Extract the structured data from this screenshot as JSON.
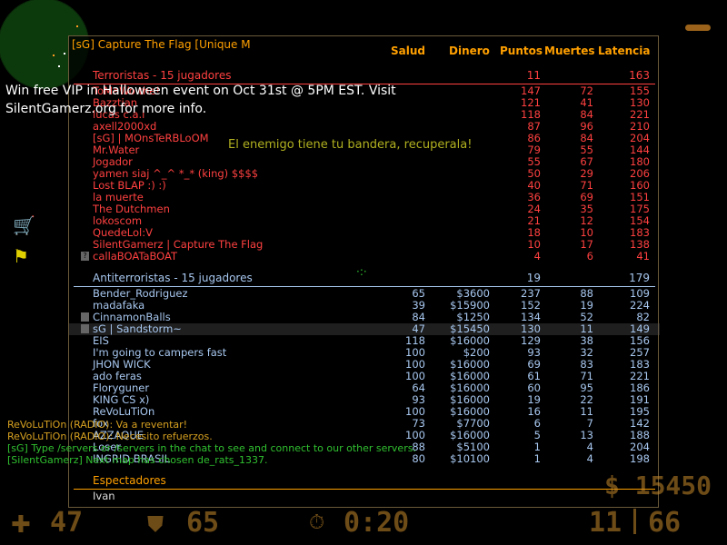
{
  "server_title": "[sG] Capture The Flag [Unique M",
  "columns": {
    "health": "Salud",
    "money": "Dinero",
    "points": "Puntos",
    "deaths": "Muertes",
    "latency": "Latencia"
  },
  "terrorists": {
    "header": "Terroristas   -  15 jugadores",
    "points": "11",
    "latency": "163",
    "players": [
      {
        "name": "ToMaWo  the!",
        "pts": "147",
        "deaths": "72",
        "lat": "155"
      },
      {
        "name": "Bazztian",
        "pts": "121",
        "deaths": "41",
        "lat": "130"
      },
      {
        "name": "lucas c.a.l",
        "pts": "118",
        "deaths": "84",
        "lat": "221"
      },
      {
        "name": "axell2000xd",
        "pts": "87",
        "deaths": "96",
        "lat": "210"
      },
      {
        "name": "[sG] | MOnsTeRBLoOM",
        "pts": "86",
        "deaths": "84",
        "lat": "204"
      },
      {
        "name": "Mr.Water",
        "pts": "79",
        "deaths": "55",
        "lat": "144"
      },
      {
        "name": "Jogador",
        "pts": "55",
        "deaths": "67",
        "lat": "180"
      },
      {
        "name": "yamen siaj ^_^ *_* (king) $$$$",
        "pts": "50",
        "deaths": "29",
        "lat": "206"
      },
      {
        "name": "Lost BLAP :) :)",
        "pts": "40",
        "deaths": "71",
        "lat": "160"
      },
      {
        "name": "la muerte",
        "pts": "36",
        "deaths": "69",
        "lat": "151"
      },
      {
        "name": "The Dutchmen",
        "pts": "24",
        "deaths": "35",
        "lat": "175"
      },
      {
        "name": "lokoscom",
        "pts": "21",
        "deaths": "12",
        "lat": "154"
      },
      {
        "name": "QuedeLol:V",
        "pts": "18",
        "deaths": "10",
        "lat": "183"
      },
      {
        "name": "SilentGamerz | Capture The Flag",
        "pts": "10",
        "deaths": "17",
        "lat": "138"
      },
      {
        "name": "callaBOATaBOAT",
        "pts": "4",
        "deaths": "6",
        "lat": "41"
      }
    ]
  },
  "counter_terrorists": {
    "header": "Antiterroristas   -  15 jugadores",
    "points": "19",
    "latency": "179",
    "players": [
      {
        "name": "Bender_Rodriguez",
        "hp": "65",
        "money": "$3600",
        "pts": "237",
        "deaths": "88",
        "lat": "109"
      },
      {
        "name": "madafaka",
        "hp": "39",
        "money": "$15900",
        "pts": "152",
        "deaths": "19",
        "lat": "224"
      },
      {
        "name": "CinnamonBalls",
        "hp": "84",
        "money": "$1250",
        "pts": "134",
        "deaths": "52",
        "lat": "82"
      },
      {
        "name": "sG | Sandstorm~",
        "hp": "47",
        "money": "$15450",
        "pts": "130",
        "deaths": "11",
        "lat": "149"
      },
      {
        "name": "EIS",
        "hp": "118",
        "money": "$16000",
        "pts": "129",
        "deaths": "38",
        "lat": "156"
      },
      {
        "name": "I'm going to campers fast",
        "hp": "100",
        "money": "$200",
        "pts": "93",
        "deaths": "32",
        "lat": "257"
      },
      {
        "name": "JHON WICK",
        "hp": "100",
        "money": "$16000",
        "pts": "69",
        "deaths": "83",
        "lat": "183"
      },
      {
        "name": "ado feras",
        "hp": "100",
        "money": "$16000",
        "pts": "61",
        "deaths": "71",
        "lat": "221"
      },
      {
        "name": "Floryguner",
        "hp": "64",
        "money": "$16000",
        "pts": "60",
        "deaths": "95",
        "lat": "186"
      },
      {
        "name": "KING CS x)",
        "hp": "93",
        "money": "$16000",
        "pts": "19",
        "deaths": "22",
        "lat": "191"
      },
      {
        "name": "ReVoLuTiOn",
        "hp": "100",
        "money": "$16000",
        "pts": "16",
        "deaths": "11",
        "lat": "195"
      },
      {
        "name": "fox",
        "hp": "73",
        "money": "$7700",
        "pts": "6",
        "deaths": "7",
        "lat": "142"
      },
      {
        "name": "AZZAQUE",
        "hp": "100",
        "money": "$16000",
        "pts": "5",
        "deaths": "13",
        "lat": "188"
      },
      {
        "name": "Loser",
        "hp": "88",
        "money": "$5100",
        "pts": "1",
        "deaths": "4",
        "lat": "204"
      },
      {
        "name": "INGRID BRASIL",
        "hp": "80",
        "money": "$10100",
        "pts": "1",
        "deaths": "4",
        "lat": "198"
      }
    ]
  },
  "spectators": {
    "header": "Espectadores",
    "players": [
      "Ivan"
    ]
  },
  "messages": {
    "win_line1": "Win free VIP in Halloween event on Oct 31st @ 5PM EST. Visit",
    "win_line2": "SilentGamerz.org for more info.",
    "enemy_flag": "El enemigo tiene tu bandera, recuperala!",
    "chat": [
      {
        "text": "ReVoLuTiOn (RADIO):   Va a reventar!",
        "color": "#d6a020"
      },
      {
        "text": "ReVoLuTiOn (RADIO):   Necesito refuerzos.",
        "color": "#d6a020"
      },
      {
        "text": "[sG] Type /servers or /servers in the chat to see and connect to our other servers.",
        "color": "#30c030"
      },
      {
        "text": "[SilentGamerz] Next map has chosen de_rats_1337.",
        "color": "#30c030"
      }
    ]
  },
  "hud": {
    "health": "47",
    "armor": "65",
    "timer": "0:20",
    "ammo_clip": "11",
    "ammo_reserve": "66",
    "money": "$ 15450"
  }
}
